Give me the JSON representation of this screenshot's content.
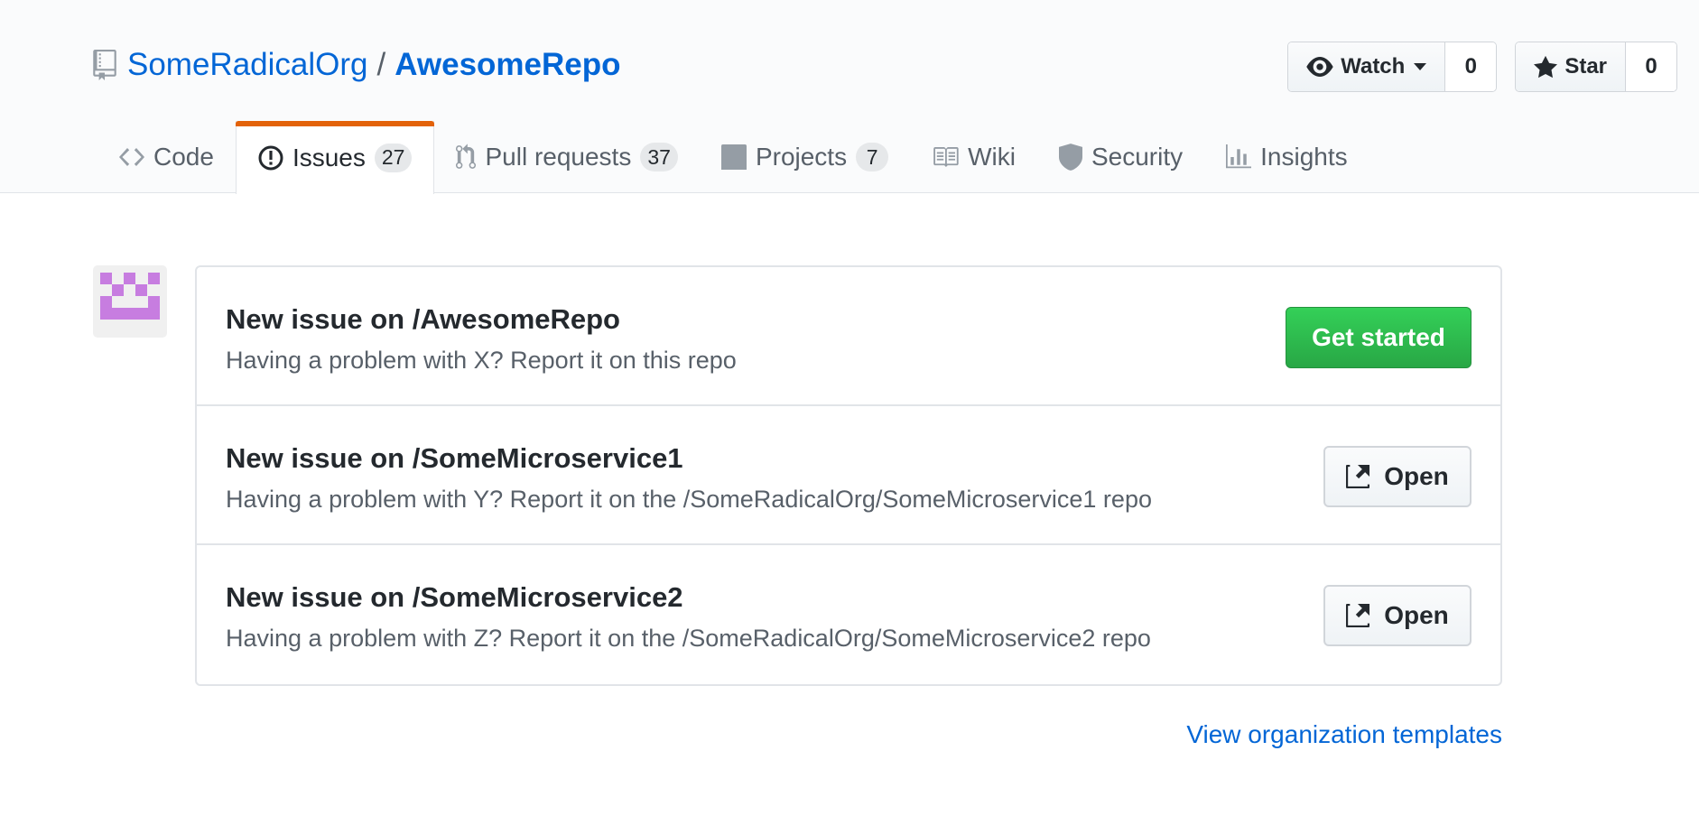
{
  "repo": {
    "owner": "SomeRadicalOrg",
    "separator": "/",
    "name": "AwesomeRepo"
  },
  "actions": {
    "watch": {
      "label": "Watch",
      "count": "0"
    },
    "star": {
      "label": "Star",
      "count": "0"
    }
  },
  "tabs": [
    {
      "label": "Code",
      "icon": "code-icon",
      "count": null
    },
    {
      "label": "Issues",
      "icon": "issue-opened-icon",
      "count": "27",
      "selected": true
    },
    {
      "label": "Pull requests",
      "icon": "git-pull-request-icon",
      "count": "37"
    },
    {
      "label": "Projects",
      "icon": "project-icon",
      "count": "7"
    },
    {
      "label": "Wiki",
      "icon": "book-icon",
      "count": null
    },
    {
      "label": "Security",
      "icon": "shield-icon",
      "count": null
    },
    {
      "label": "Insights",
      "icon": "graph-icon",
      "count": null
    }
  ],
  "templates": [
    {
      "title": "New issue on /AwesomeRepo",
      "description": "Having a problem with X? Report it on this repo",
      "button": "Get started",
      "button_type": "primary"
    },
    {
      "title": "New issue on /SomeMicroservice1",
      "description": "Having a problem with Y? Report it on the /SomeRadicalOrg/SomeMicroservice1 repo",
      "button": "Open",
      "button_type": "external-link"
    },
    {
      "title": "New issue on /SomeMicroservice2",
      "description": "Having a problem with Z? Report it on the /SomeRadicalOrg/SomeMicroservice2 repo",
      "button": "Open",
      "button_type": "external-link"
    }
  ],
  "footer": {
    "view_org_templates": "View organization templates"
  },
  "colors": {
    "link": "#0366d6",
    "primary_button": "#28a745",
    "selected_tab_accent": "#e36209",
    "avatar": "#c77de0"
  }
}
